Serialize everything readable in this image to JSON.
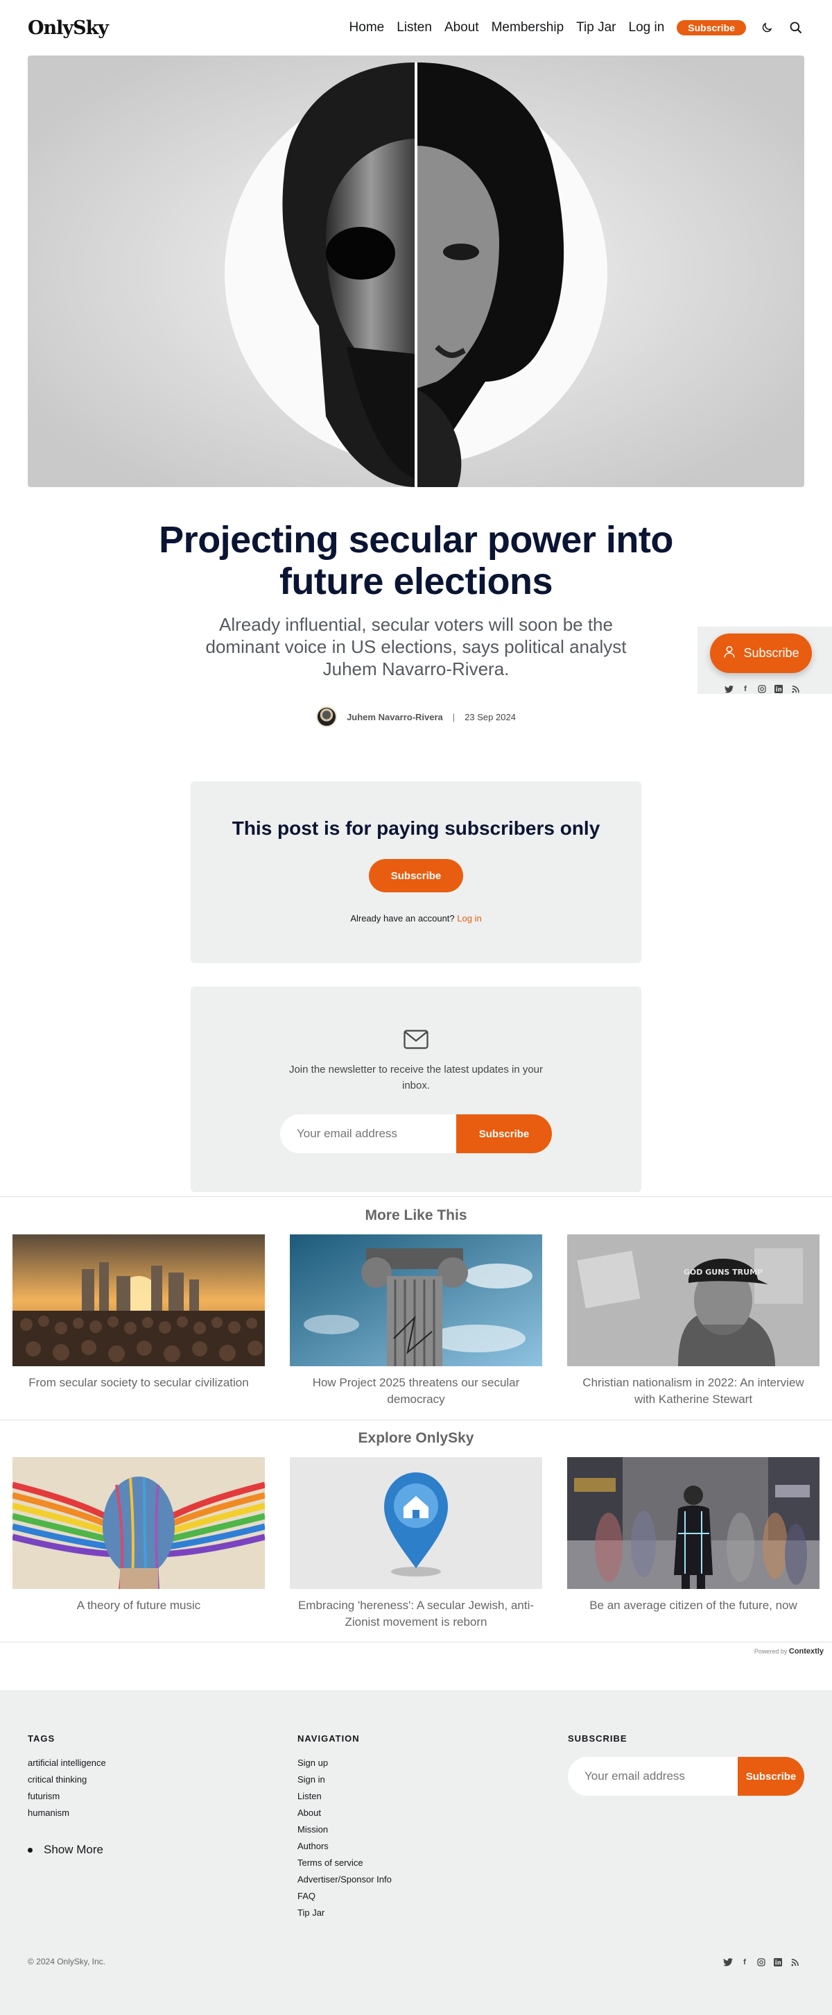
{
  "header": {
    "logo": "OnlySky",
    "nav": [
      "Home",
      "Listen",
      "About",
      "Membership",
      "Tip Jar",
      "Log in"
    ],
    "subscribe_label": "Subscribe"
  },
  "post": {
    "title": "Projecting secular power into future elections",
    "excerpt": "Already influential, secular voters will soon be the dominant voice in US elections, says political analyst Juhem Navarro-Rivera.",
    "author": "Juhem Navarro-Rivera",
    "separator": "|",
    "date": "23 Sep 2024"
  },
  "floating": {
    "subscribe_label": "Subscribe",
    "social": [
      "twitter-icon",
      "facebook-icon",
      "instagram-icon",
      "linkedin-icon",
      "rss-icon"
    ]
  },
  "paywall": {
    "heading": "This post is for paying subscribers only",
    "button": "Subscribe",
    "account_text": "Already have an account?",
    "login_link": "Log in"
  },
  "newsletter": {
    "text": "Join the newsletter to receive the latest updates in your inbox.",
    "placeholder": "Your email address",
    "button": "Subscribe"
  },
  "more_like_this": {
    "title": "More Like This",
    "cards": [
      {
        "caption": "From secular society to secular civilization"
      },
      {
        "caption": "How Project 2025 threatens our secular democracy"
      },
      {
        "caption": "Christian nationalism in 2022: An interview with Katherine Stewart"
      }
    ],
    "hat_text": "GOD GUNS TRUMP"
  },
  "explore": {
    "title": "Explore OnlySky",
    "cards": [
      {
        "caption": "A theory of future music"
      },
      {
        "caption": "Embracing 'hereness': A secular Jewish, anti-Zionist movement is reborn"
      },
      {
        "caption": "Be an average citizen of the future, now"
      }
    ]
  },
  "powered": {
    "label": "Powered by",
    "brand": "Contextly"
  },
  "footer": {
    "tags_title": "TAGS",
    "tags": [
      "artificial intelligence",
      "critical thinking",
      "futurism",
      "humanism"
    ],
    "show_more": "Show More",
    "nav_title": "NAVIGATION",
    "nav": [
      "Sign up",
      "Sign in",
      "Listen",
      "About",
      "Mission",
      "Authors",
      "Terms of service",
      "Advertiser/Sponsor Info",
      "FAQ",
      "Tip Jar"
    ],
    "subscribe_title": "SUBSCRIBE",
    "placeholder": "Your email address",
    "button": "Subscribe",
    "copyright": "© 2024 OnlySky, Inc."
  },
  "colors": {
    "accent": "#e85d10",
    "title": "#0a1433",
    "panel": "#eeefef"
  }
}
